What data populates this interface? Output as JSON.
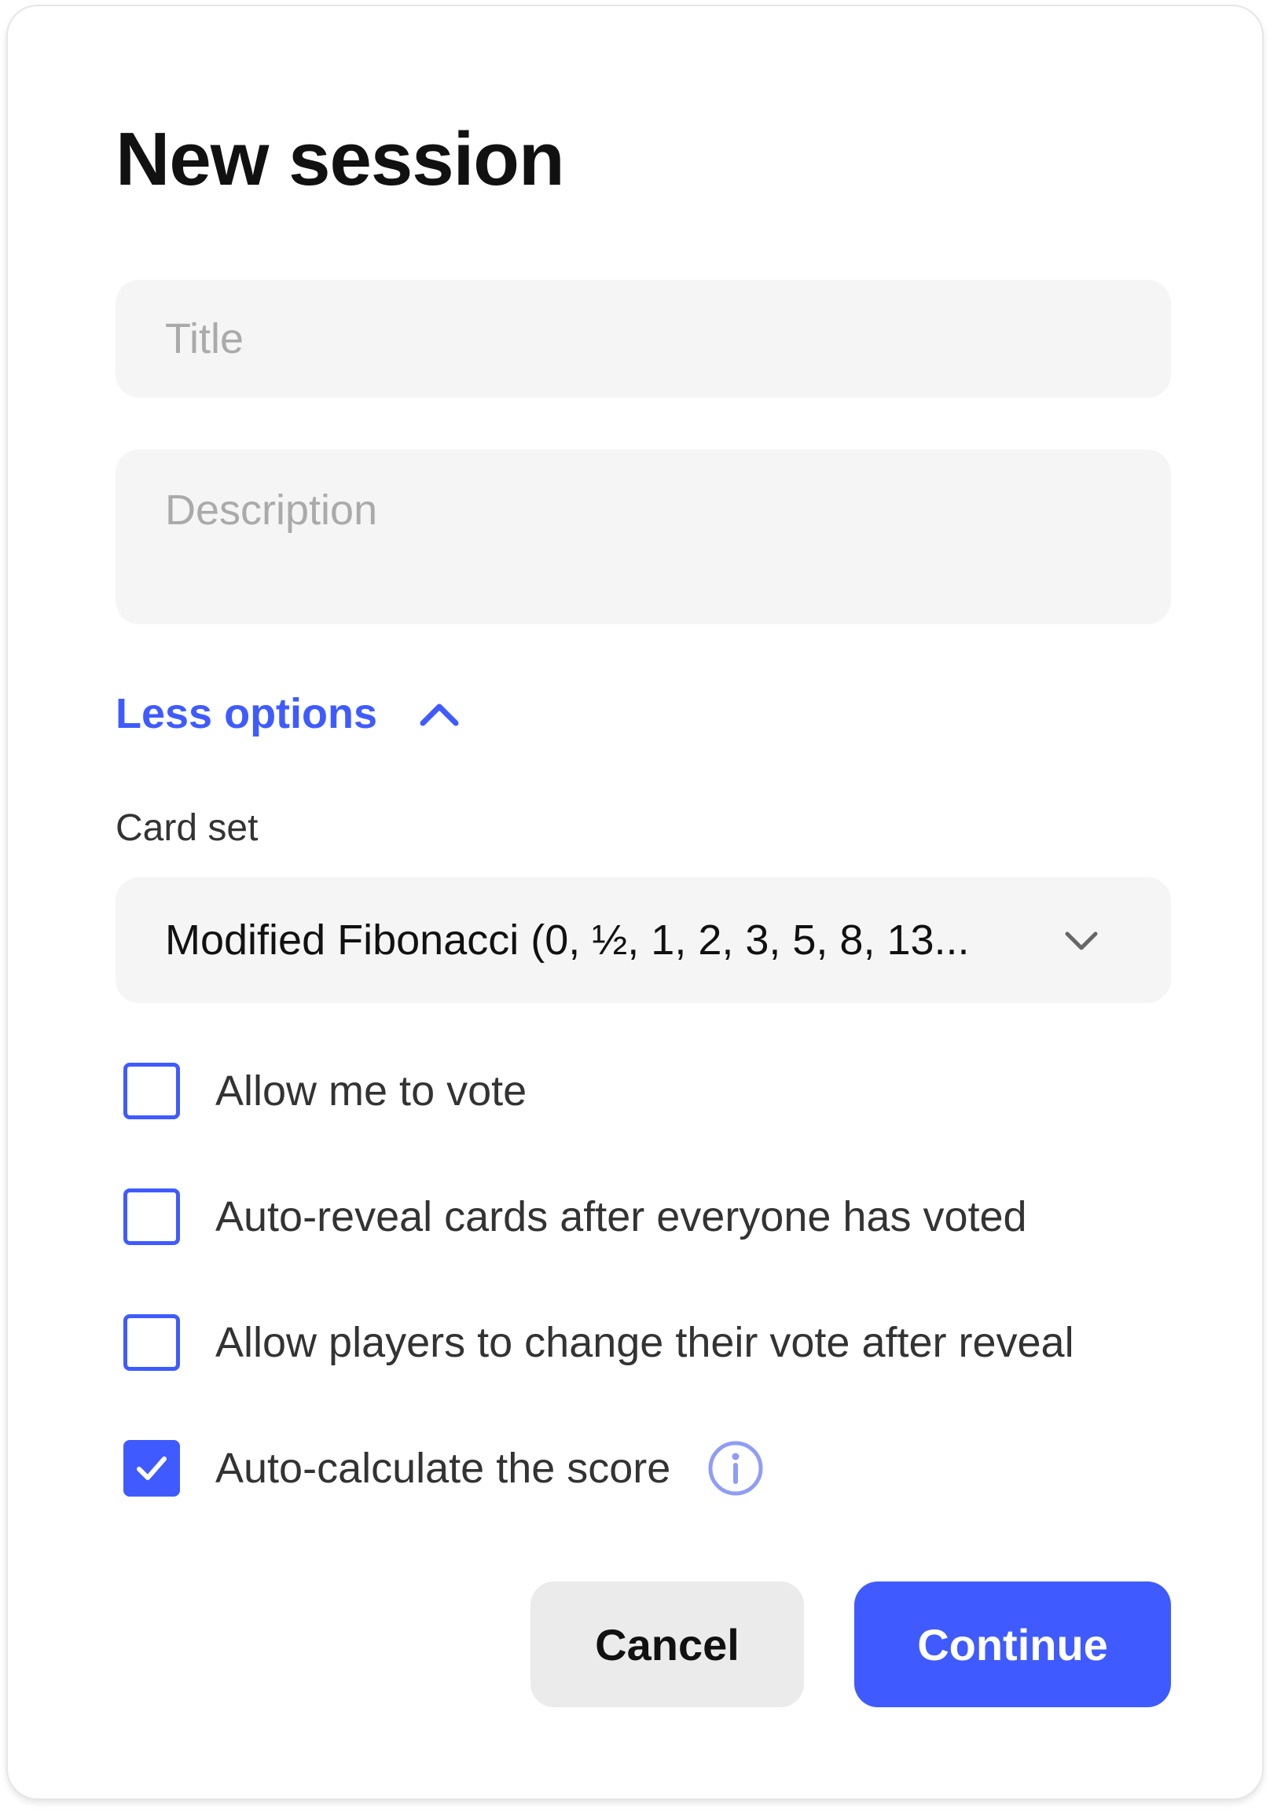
{
  "dialog": {
    "title": "New session"
  },
  "form": {
    "title_placeholder": "Title",
    "description_placeholder": "Description",
    "toggle_options_label": "Less options",
    "card_set_label": "Card set",
    "card_set_value": "Modified Fibonacci (0, ½, 1, 2, 3, 5, 8, 13...",
    "options": [
      {
        "label": "Allow me to vote",
        "checked": false
      },
      {
        "label": "Auto-reveal cards after everyone has voted",
        "checked": false
      },
      {
        "label": "Allow players to change their vote after reveal",
        "checked": false
      },
      {
        "label": "Auto-calculate the score",
        "checked": true
      }
    ]
  },
  "actions": {
    "cancel_label": "Cancel",
    "continue_label": "Continue"
  },
  "icons": {
    "toggle": "chevron-up-icon",
    "select": "chevron-down-icon",
    "check": "checkmark-icon",
    "info": "info-icon"
  },
  "colors": {
    "accent": "#3f5bff",
    "field_bg": "#f5f5f5",
    "cancel_bg": "#ebebeb",
    "info": "#8f9df5"
  }
}
